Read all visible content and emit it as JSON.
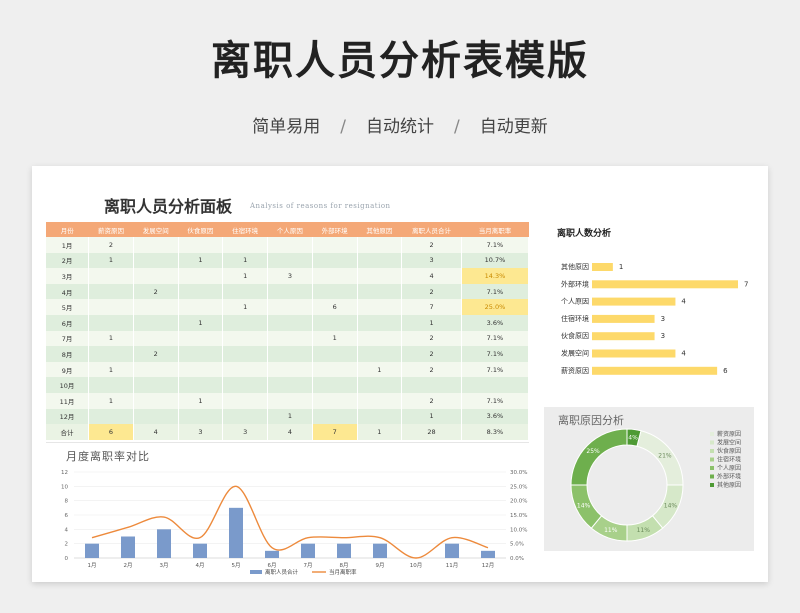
{
  "header": {
    "title": "离职人员分析表模版",
    "tags": [
      "简单易用",
      "自动统计",
      "自动更新"
    ],
    "separator": "/"
  },
  "dashboard": {
    "title": "离职人员分析面板",
    "subtitle": "Analysis of reasons for resignation"
  },
  "table": {
    "columns": [
      "月份",
      "薪资原因",
      "发展空间",
      "伙食原因",
      "住宿环境",
      "个人原因",
      "外部环境",
      "其他原因",
      "离职人员合计",
      "当月离职率"
    ],
    "rows": [
      {
        "month": "1月",
        "cells": [
          "2",
          "",
          "",
          "",
          "",
          "",
          ""
        ],
        "total": "2",
        "rate": "7.1%",
        "hl": false
      },
      {
        "month": "2月",
        "cells": [
          "1",
          "",
          "1",
          "1",
          "",
          "",
          ""
        ],
        "total": "3",
        "rate": "10.7%",
        "hl": false
      },
      {
        "month": "3月",
        "cells": [
          "",
          "",
          "",
          "1",
          "3",
          "",
          ""
        ],
        "total": "4",
        "rate": "14.3%",
        "hl": true
      },
      {
        "month": "4月",
        "cells": [
          "",
          "2",
          "",
          "",
          "",
          "",
          ""
        ],
        "total": "2",
        "rate": "7.1%",
        "hl": false
      },
      {
        "month": "5月",
        "cells": [
          "",
          "",
          "",
          "1",
          "",
          "6",
          ""
        ],
        "total": "7",
        "rate": "25.0%",
        "hl": true
      },
      {
        "month": "6月",
        "cells": [
          "",
          "",
          "1",
          "",
          "",
          "",
          ""
        ],
        "total": "1",
        "rate": "3.6%",
        "hl": false
      },
      {
        "month": "7月",
        "cells": [
          "1",
          "",
          "",
          "",
          "",
          "1",
          ""
        ],
        "total": "2",
        "rate": "7.1%",
        "hl": false
      },
      {
        "month": "8月",
        "cells": [
          "",
          "2",
          "",
          "",
          "",
          "",
          ""
        ],
        "total": "2",
        "rate": "7.1%",
        "hl": false
      },
      {
        "month": "9月",
        "cells": [
          "1",
          "",
          "",
          "",
          "",
          "",
          "1"
        ],
        "total": "2",
        "rate": "7.1%",
        "hl": false
      },
      {
        "month": "10月",
        "cells": [
          "",
          "",
          "",
          "",
          "",
          "",
          ""
        ],
        "total": "",
        "rate": "",
        "hl": false
      },
      {
        "month": "11月",
        "cells": [
          "1",
          "",
          "1",
          "",
          "",
          "",
          ""
        ],
        "total": "2",
        "rate": "7.1%",
        "hl": false
      },
      {
        "month": "12月",
        "cells": [
          "",
          "",
          "",
          "",
          "1",
          "",
          ""
        ],
        "total": "1",
        "rate": "3.6%",
        "hl": false
      }
    ],
    "total_row": {
      "label": "合计",
      "cells": [
        "6",
        "4",
        "3",
        "3",
        "4",
        "7",
        "1"
      ],
      "total": "28",
      "rate": "8.3%"
    }
  },
  "bar_chart": {
    "title": "离职人数分析",
    "color": "#fdd96a",
    "chart_data": {
      "type": "bar",
      "orientation": "horizontal",
      "categories": [
        "其他原因",
        "外部环境",
        "个人原因",
        "住宿环境",
        "伙食原因",
        "发展空间",
        "薪资原因"
      ],
      "values": [
        1,
        7,
        4,
        3,
        3,
        4,
        6
      ],
      "xlim": [
        0,
        7
      ]
    }
  },
  "pie_chart": {
    "title": "离职原因分析",
    "colors": [
      "#e4eedc",
      "#d6e8c9",
      "#c3dfaf",
      "#a8d08a",
      "#8cc16a",
      "#6eaf4d",
      "#4e9a34"
    ],
    "chart_data": {
      "type": "pie",
      "donut": true,
      "labels": [
        "薪资原因",
        "发展空间",
        "伙食原因",
        "住宿环境",
        "个人原因",
        "外部环境",
        "其他原因"
      ],
      "values": [
        21,
        14,
        11,
        11,
        14,
        25,
        4
      ],
      "value_labels": [
        "21%",
        "14%",
        "11%",
        "11%",
        "14%",
        "25%",
        "4%"
      ]
    }
  },
  "line_chart": {
    "title": "月度离职率对比",
    "bar_color": "#7a9acb",
    "line_color": "#ed8a3c",
    "legend": [
      "离职人员合计",
      "当月离职率"
    ],
    "chart_data": {
      "type": "bar",
      "categories": [
        "1月",
        "2月",
        "3月",
        "4月",
        "5月",
        "6月",
        "7月",
        "8月",
        "9月",
        "10月",
        "11月",
        "12月"
      ],
      "series": [
        {
          "name": "离职人员合计",
          "type": "bar",
          "axis": "left",
          "values": [
            2,
            3,
            4,
            2,
            7,
            1,
            2,
            2,
            2,
            0,
            2,
            1
          ]
        },
        {
          "name": "当月离职率",
          "type": "line",
          "axis": "right",
          "values": [
            7.1,
            10.7,
            14.3,
            7.1,
            25.0,
            3.6,
            7.1,
            7.1,
            7.1,
            0,
            7.1,
            3.6
          ]
        }
      ],
      "y_left_ticks": [
        "0",
        "2",
        "4",
        "6",
        "8",
        "10",
        "12"
      ],
      "y_right_ticks": [
        "0.0%",
        "5.0%",
        "10.0%",
        "15.0%",
        "20.0%",
        "25.0%",
        "30.0%"
      ],
      "ylim_left": [
        0,
        12
      ],
      "ylim_right": [
        0,
        30
      ]
    }
  }
}
